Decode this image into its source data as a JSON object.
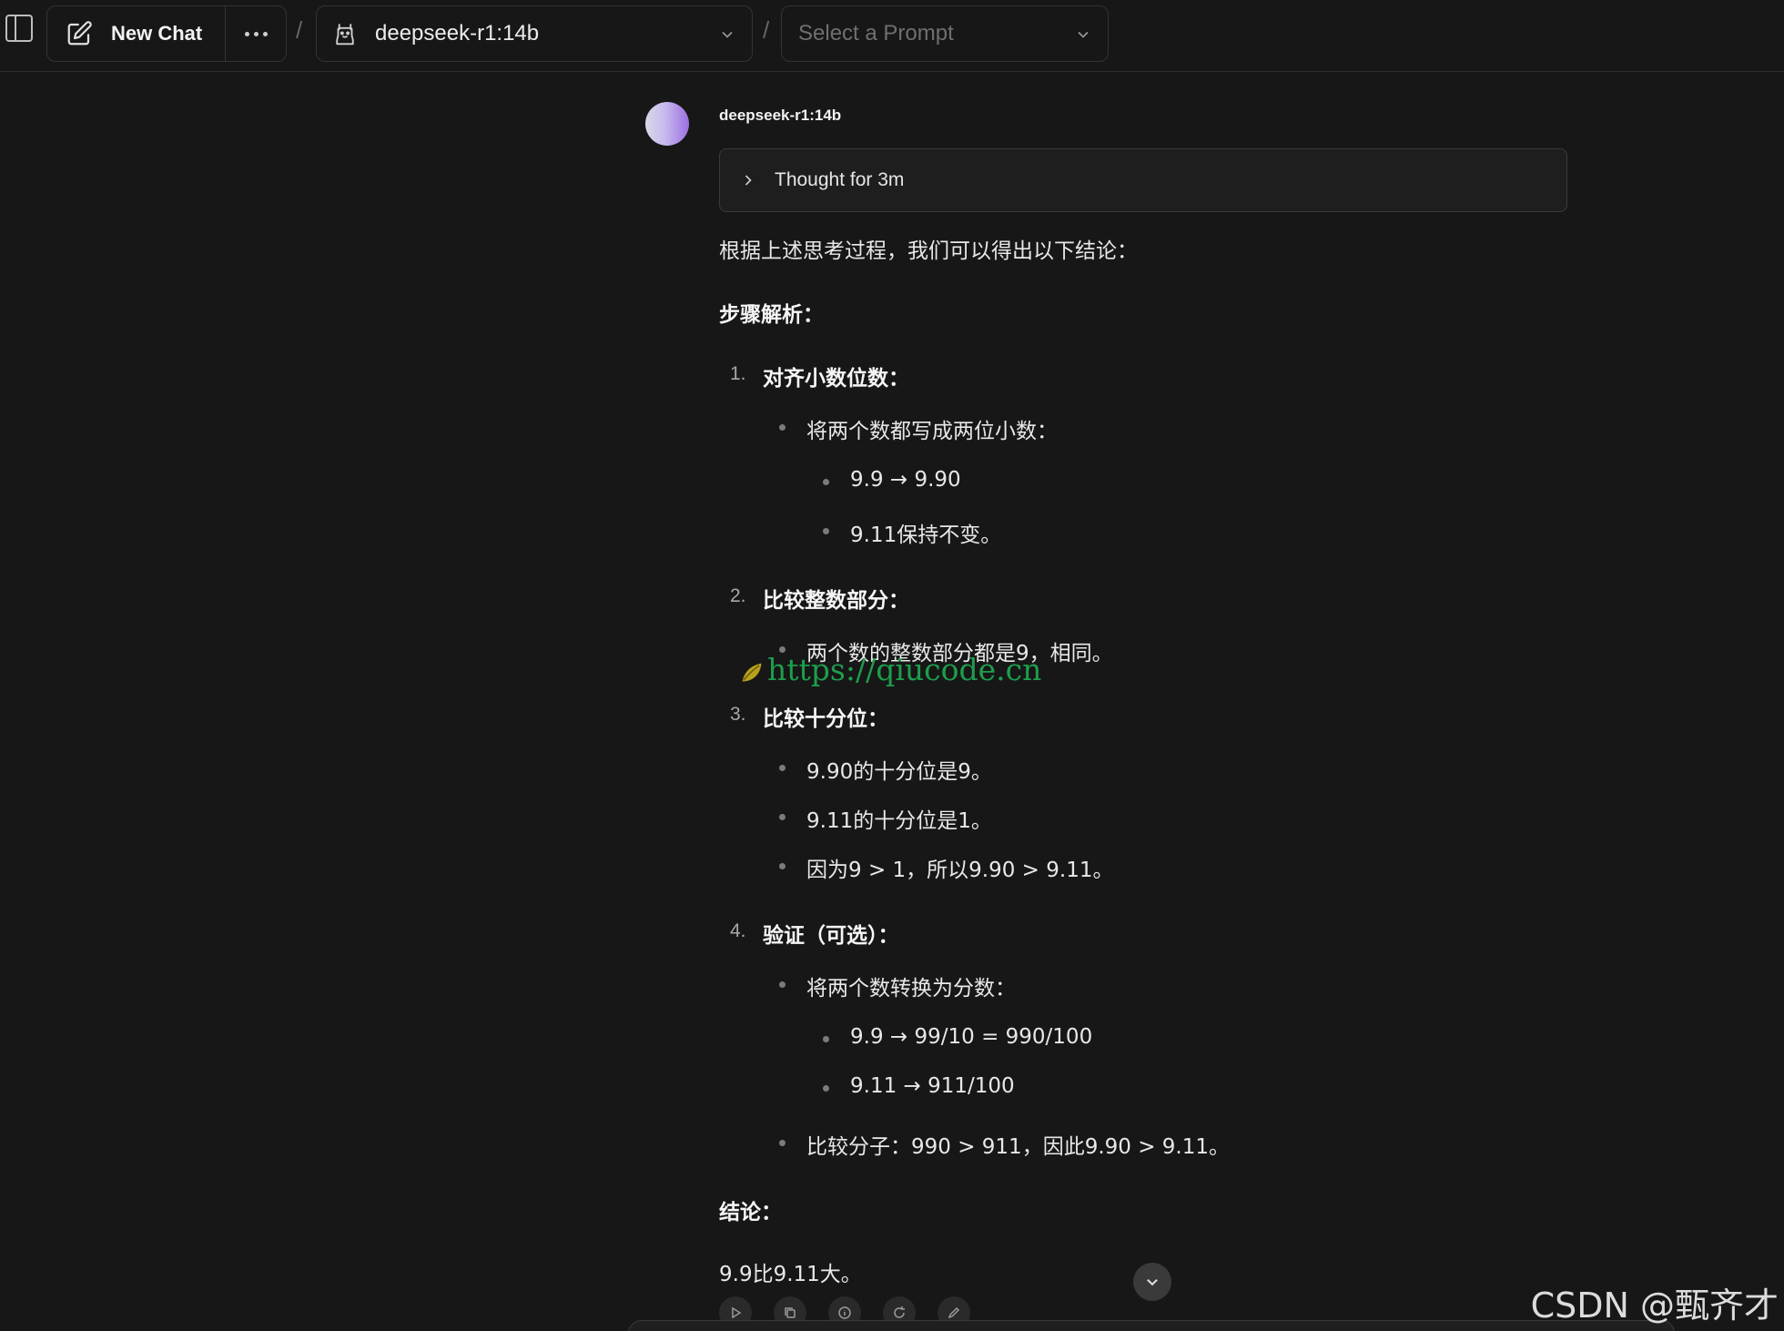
{
  "header": {
    "new_chat_label": "New Chat",
    "model_label": "deepseek-r1:14b",
    "prompt_placeholder": "Select a Prompt",
    "separator": "/"
  },
  "message": {
    "model_name": "deepseek-r1:14b",
    "thought_label": "Thought for 3m",
    "intro": "根据上述思考过程，我们可以得出以下结论：",
    "steps_heading": "步骤解析：",
    "step1": {
      "num": "1.",
      "title": "对齐小数位数：",
      "b1": "将两个数都写成两位小数：",
      "s1": "9.9 → 9.90",
      "s2": "9.11保持不变。"
    },
    "step2": {
      "num": "2.",
      "title": "比较整数部分：",
      "b1": "两个数的整数部分都是9，相同。"
    },
    "step3": {
      "num": "3.",
      "title": "比较十分位：",
      "b1": "9.90的十分位是9。",
      "b2": "9.11的十分位是1。",
      "b3": "因为9 > 1，所以9.90 > 9.11。"
    },
    "step4": {
      "num": "4.",
      "title": "验证（可选）：",
      "b1": "将两个数转换为分数：",
      "s1": "9.9 → 99/10 = 990/100",
      "s2": "9.11 → 911/100",
      "b2": "比较分子：990 > 911，因此9.90 > 9.11。"
    },
    "conclusion_heading": "结论：",
    "conclusion": "9.9比9.11大。"
  },
  "overlay": {
    "watermark": "https://qiucode.cn",
    "csdn": "CSDN @甄齐才"
  }
}
